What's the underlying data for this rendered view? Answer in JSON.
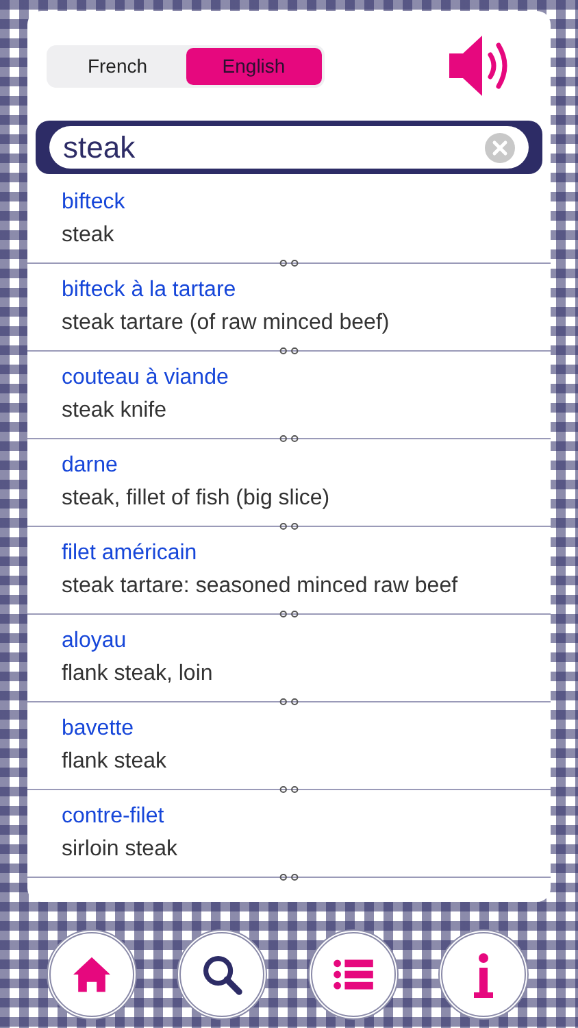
{
  "language_toggle": [
    {
      "label": "French",
      "selected": false
    },
    {
      "label": "English",
      "selected": true
    }
  ],
  "search": {
    "value": "steak"
  },
  "entries": [
    {
      "term": "bifteck",
      "translation": "steak"
    },
    {
      "term": "bifteck à la tartare",
      "translation": "steak tartare (of raw minced beef)"
    },
    {
      "term": "couteau à viande",
      "translation": "steak knife"
    },
    {
      "term": "darne",
      "translation": "steak, fillet of fish (big slice)"
    },
    {
      "term": "filet américain",
      "translation": "steak tartare: seasoned minced raw beef"
    },
    {
      "term": "aloyau",
      "translation": "flank steak, loin"
    },
    {
      "term": "bavette",
      "translation": "flank steak"
    },
    {
      "term": "contre-filet",
      "translation": "sirloin steak"
    }
  ],
  "nav": [
    {
      "kind": "home"
    },
    {
      "kind": "search"
    },
    {
      "kind": "list"
    },
    {
      "kind": "info"
    }
  ]
}
